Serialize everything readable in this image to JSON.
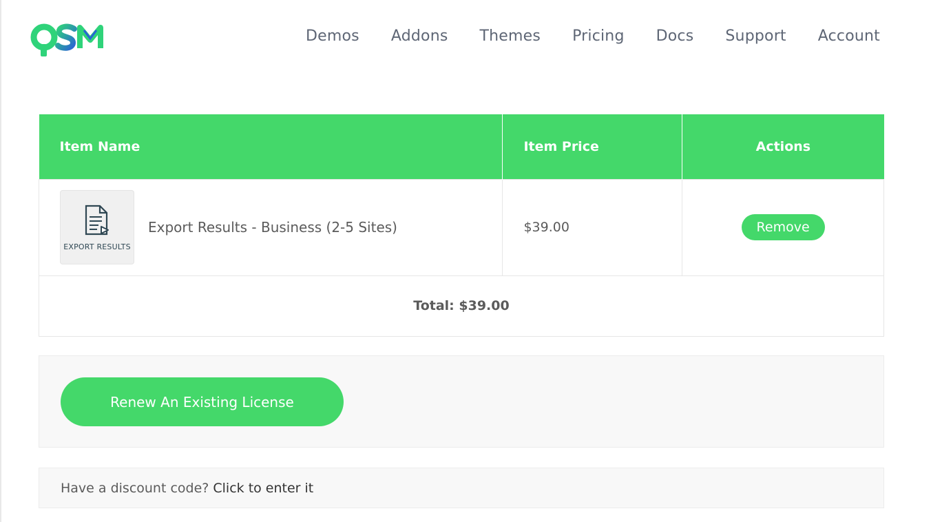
{
  "header": {
    "logo_text": "QSM",
    "nav": [
      {
        "label": "Demos"
      },
      {
        "label": "Addons"
      },
      {
        "label": "Themes"
      },
      {
        "label": "Pricing"
      },
      {
        "label": "Docs"
      },
      {
        "label": "Support"
      },
      {
        "label": "Account"
      }
    ]
  },
  "cart": {
    "columns": {
      "name": "Item Name",
      "price": "Item Price",
      "actions": "Actions"
    },
    "items": [
      {
        "thumbnail_label": "EXPORT RESULTS",
        "thumbnail_icon": "document-export-icon",
        "name": "Export Results - Business (2-5 Sites)",
        "price": "$39.00",
        "remove_label": "Remove"
      }
    ],
    "total": "Total: $39.00"
  },
  "renew": {
    "button_label": "Renew An Existing License"
  },
  "discount": {
    "prompt": "Have a discount code?",
    "link": "Click to enter it"
  },
  "colors": {
    "accent": "#44d86a",
    "logo_green": "#2fd37a",
    "logo_blue": "#2a62d6"
  }
}
